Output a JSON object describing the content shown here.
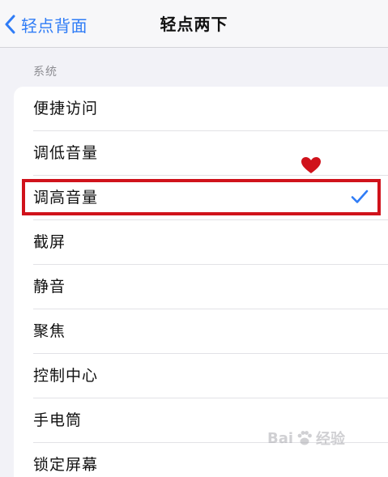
{
  "nav": {
    "back_label": "轻点背面",
    "title": "轻点两下"
  },
  "section": {
    "header": "系统"
  },
  "options": [
    {
      "label": "便捷访问",
      "selected": false
    },
    {
      "label": "调低音量",
      "selected": false
    },
    {
      "label": "调高音量",
      "selected": true
    },
    {
      "label": "截屏",
      "selected": false
    },
    {
      "label": "静音",
      "selected": false
    },
    {
      "label": "聚焦",
      "selected": false
    },
    {
      "label": "控制中心",
      "selected": false
    },
    {
      "label": "手电筒",
      "selected": false
    },
    {
      "label": "锁定屏幕",
      "selected": false
    }
  ],
  "watermark": {
    "left": "Bai",
    "right": "经验"
  },
  "colors": {
    "accent": "#2f7cf6",
    "highlight": "#d0121b",
    "heart": "#d0121b",
    "background": "#f2f2f7"
  },
  "icons": {
    "back": "chevron-left-icon",
    "selected": "checkmark-icon",
    "annotation": "heart-icon",
    "watermark": "paw-icon"
  }
}
